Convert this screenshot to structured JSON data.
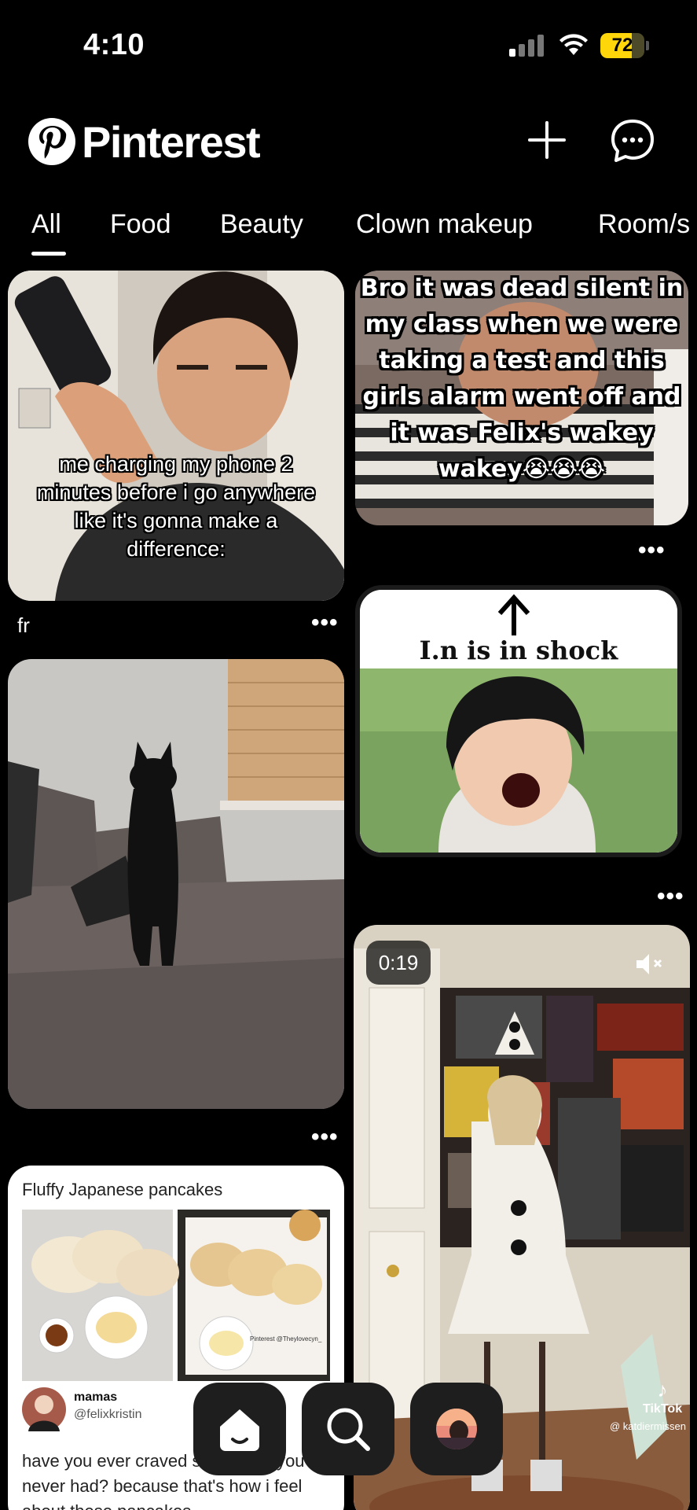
{
  "status_bar": {
    "time": "4:10",
    "battery": "72",
    "battery_level": 0.72
  },
  "header": {
    "app_name": "Pinterest",
    "create_icon": "plus-icon",
    "messages_icon": "chat-icon"
  },
  "tabs": [
    {
      "label": "All",
      "selected": true
    },
    {
      "label": "Food"
    },
    {
      "label": "Beauty"
    },
    {
      "label": "Clown makeup"
    },
    {
      "label": "Room/s"
    }
  ],
  "pins": [
    {
      "caption": "me charging my phone 2 minutes before i go anywhere like it's gonna make a difference:",
      "title": "fr",
      "more": "•••"
    },
    {
      "caption": "Bro it was dead silent in my class when we were taking a test and this girls alarm went off and it was Felix's wakey wakey😭😭😭",
      "more": "•••"
    },
    {
      "caption": "I.n is in shock",
      "more": "•••"
    },
    {
      "caption": "",
      "more": "•••"
    },
    {
      "duration": "0:19",
      "mute_icon": "mute-icon",
      "tiktok_label": "TikTok",
      "tiktok_handle": "@ katdiermissen"
    },
    {
      "title": "Fluffy Japanese pancakes",
      "watermark": "Pinterest @Theylovecyn_",
      "user_name": "mamas",
      "user_handle": "@felixkristin",
      "description": "have you ever craved something you've never had? because that's how i feel about these pancakes"
    }
  ],
  "bottom_nav": [
    {
      "icon": "home-icon"
    },
    {
      "icon": "search-icon"
    },
    {
      "icon": "profile-avatar"
    }
  ],
  "colors": {
    "background": "#000000",
    "battery_fill": "#ffd60a",
    "card_white": "#ffffff"
  }
}
